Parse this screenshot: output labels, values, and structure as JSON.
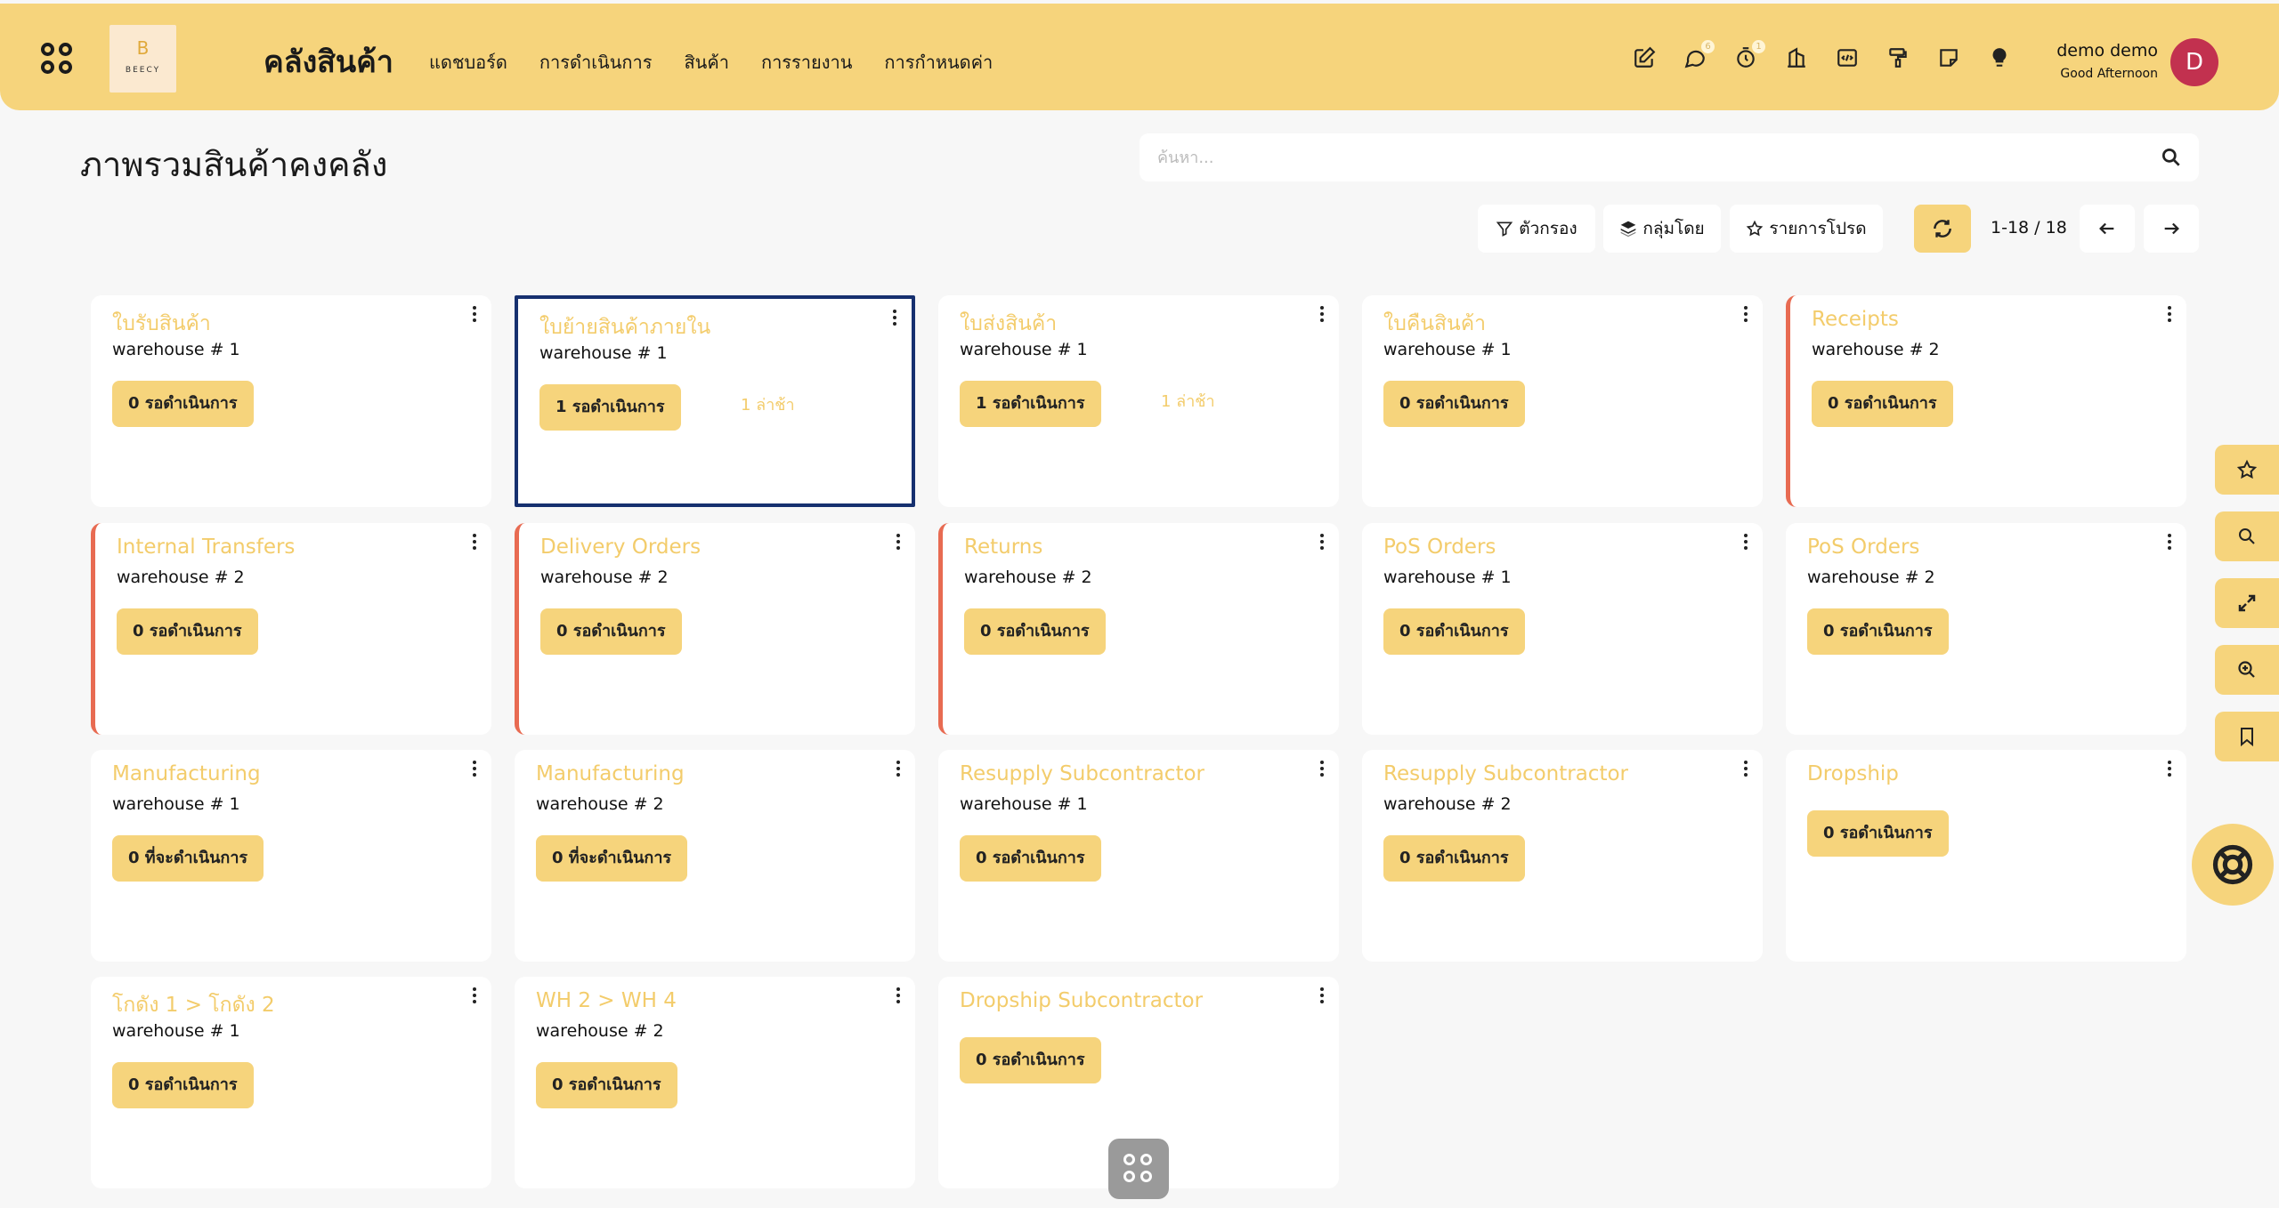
{
  "app": {
    "title": "คลังสินค้า",
    "logo_letter": "B",
    "logo_text": "BEECY",
    "nav": [
      "แดชบอร์ด",
      "การดำเนินการ",
      "สินค้า",
      "การรายงาน",
      "การกำหนดค่า"
    ]
  },
  "system_tray": {
    "chat_badge": "6",
    "timer_badge": "1"
  },
  "user": {
    "name": "demo demo",
    "greeting": "Good Afternoon",
    "initial": "D",
    "avatar_color": "#c2314f"
  },
  "page": {
    "title": "ภาพรวมสินค้าคงคลัง",
    "search_placeholder": "ค้นหา...",
    "filter_label": "ตัวกรอง",
    "groupby_label": "กลุ่มโดย",
    "favorites_label": "รายการโปรด",
    "pager": "1-18 / 18"
  },
  "cards": [
    {
      "title": "ใบรับสินค้า",
      "warehouse": "warehouse # 1",
      "button": "0 รอดำเนินการ",
      "late": ""
    },
    {
      "title": "ใบย้ายสินค้าภายใน",
      "warehouse": "warehouse # 1",
      "button": "1 รอดำเนินการ",
      "late": "1 ล่าช้า"
    },
    {
      "title": "ใบส่งสินค้า",
      "warehouse": "warehouse # 1",
      "button": "1 รอดำเนินการ",
      "late": "1 ล่าช้า"
    },
    {
      "title": "ใบคืนสินค้า",
      "warehouse": "warehouse # 1",
      "button": "0 รอดำเนินการ",
      "late": ""
    },
    {
      "title": "Receipts",
      "warehouse": "warehouse # 2",
      "button": "0 รอดำเนินการ",
      "late": ""
    },
    {
      "title": "Internal Transfers",
      "warehouse": "warehouse # 2",
      "button": "0 รอดำเนินการ",
      "late": ""
    },
    {
      "title": "Delivery Orders",
      "warehouse": "warehouse # 2",
      "button": "0 รอดำเนินการ",
      "late": ""
    },
    {
      "title": "Returns",
      "warehouse": "warehouse # 2",
      "button": "0 รอดำเนินการ",
      "late": ""
    },
    {
      "title": "PoS Orders",
      "warehouse": "warehouse # 1",
      "button": "0 รอดำเนินการ",
      "late": ""
    },
    {
      "title": "PoS Orders",
      "warehouse": "warehouse # 2",
      "button": "0 รอดำเนินการ",
      "late": ""
    },
    {
      "title": "Manufacturing",
      "warehouse": "warehouse # 1",
      "button": "0 ที่จะดำเนินการ",
      "late": ""
    },
    {
      "title": "Manufacturing",
      "warehouse": "warehouse # 2",
      "button": "0 ที่จะดำเนินการ",
      "late": ""
    },
    {
      "title": "Resupply Subcontractor",
      "warehouse": "warehouse # 1",
      "button": "0 รอดำเนินการ",
      "late": ""
    },
    {
      "title": "Resupply Subcontractor",
      "warehouse": "warehouse # 2",
      "button": "0 รอดำเนินการ",
      "late": ""
    },
    {
      "title": "Dropship",
      "warehouse": "",
      "button": "0 รอดำเนินการ",
      "late": ""
    },
    {
      "title": "โกดัง 1 > โกดัง 2",
      "warehouse": "warehouse # 1",
      "button": "0 รอดำเนินการ",
      "late": ""
    },
    {
      "title": "WH 2 > WH 4",
      "warehouse": "warehouse # 2",
      "button": "0 รอดำเนินการ",
      "late": ""
    },
    {
      "title": "Dropship Subcontractor",
      "warehouse": "",
      "button": "0 รอดำเนินการ",
      "late": ""
    }
  ],
  "colors": {
    "accent": "#f6d47c",
    "card_title": "#f3cc6b",
    "alert_border": "#e86b52",
    "selected_border": "#16306f"
  }
}
